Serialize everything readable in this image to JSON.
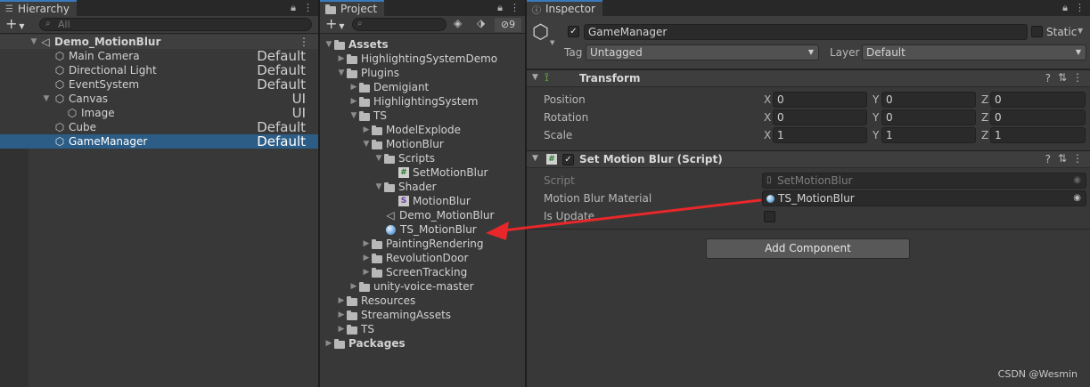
{
  "hierarchy": {
    "tab_title": "Hierarchy",
    "search_placeholder": "All",
    "add_label": "+",
    "rows": [
      {
        "label": "Demo_MotionBlur",
        "right": ""
      },
      {
        "label": "Main Camera",
        "right": "Default"
      },
      {
        "label": "Directional Light",
        "right": "Default"
      },
      {
        "label": "EventSystem",
        "right": "Default"
      },
      {
        "label": "Canvas",
        "right": "UI"
      },
      {
        "label": "Image",
        "right": "UI"
      },
      {
        "label": "Cube",
        "right": "Default"
      },
      {
        "label": "GameManager",
        "right": "Default"
      }
    ]
  },
  "project": {
    "tab_title": "Project",
    "add_label": "+",
    "hidden_count": "9",
    "rows": [
      {
        "label": "Assets"
      },
      {
        "label": "HighlightingSystemDemo"
      },
      {
        "label": "Plugins"
      },
      {
        "label": "Demigiant"
      },
      {
        "label": "HighlightingSystem"
      },
      {
        "label": "TS"
      },
      {
        "label": "ModelExplode"
      },
      {
        "label": "MotionBlur"
      },
      {
        "label": "Scripts"
      },
      {
        "label": "SetMotionBlur"
      },
      {
        "label": "Shader"
      },
      {
        "label": "MotionBlur"
      },
      {
        "label": "Demo_MotionBlur"
      },
      {
        "label": "TS_MotionBlur"
      },
      {
        "label": "PaintingRendering"
      },
      {
        "label": "RevolutionDoor"
      },
      {
        "label": "ScreenTracking"
      },
      {
        "label": "unity-voice-master"
      },
      {
        "label": "Resources"
      },
      {
        "label": "StreamingAssets"
      },
      {
        "label": "TS"
      },
      {
        "label": "Packages"
      }
    ]
  },
  "inspector": {
    "tab_title": "Inspector",
    "object_name": "GameManager",
    "static_label": "Static",
    "tag_label": "Tag",
    "tag_value": "Untagged",
    "layer_label": "Layer",
    "layer_value": "Default",
    "transform": {
      "title": "Transform",
      "rows": [
        {
          "label": "Position",
          "x": "0",
          "y": "0",
          "z": "0"
        },
        {
          "label": "Rotation",
          "x": "0",
          "y": "0",
          "z": "0"
        },
        {
          "label": "Scale",
          "x": "1",
          "y": "1",
          "z": "1"
        }
      ],
      "axis_x": "X",
      "axis_y": "Y",
      "axis_z": "Z"
    },
    "script_component": {
      "title": "Set Motion Blur (Script)",
      "script_label": "Script",
      "script_value": "SetMotionBlur",
      "material_label": "Motion Blur Material",
      "material_value": "TS_MotionBlur",
      "is_update_label": "Is Update"
    },
    "add_component_label": "Add Component"
  },
  "watermark": "CSDN @Wesmin",
  "colors": {
    "selection": "#2c5d87",
    "accent_tab": "#3a79bb",
    "annotation_arrow": "#e8272a"
  }
}
